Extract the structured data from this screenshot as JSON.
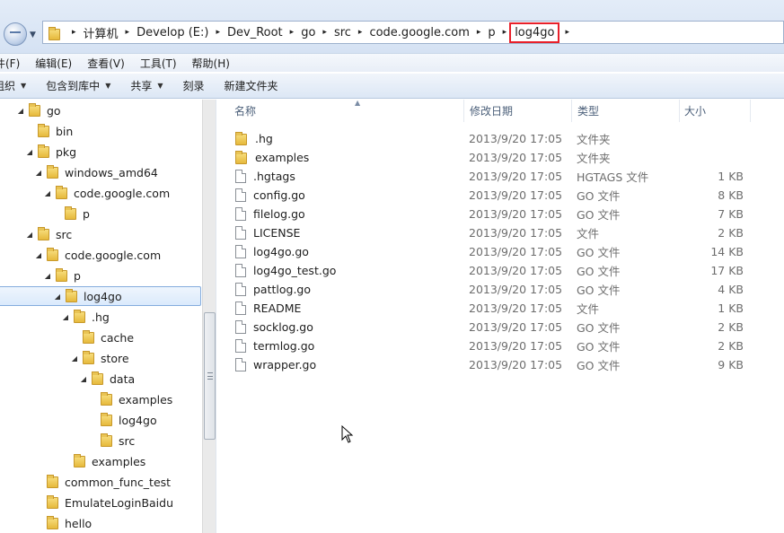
{
  "address": {
    "crumbs": [
      "计算机",
      "Develop (E:)",
      "Dev_Root",
      "go",
      "src",
      "code.google.com",
      "p"
    ],
    "current": "log4go"
  },
  "menu": [
    "件(F)",
    "编辑(E)",
    "查看(V)",
    "工具(T)",
    "帮助(H)"
  ],
  "commands": {
    "organize": "组织",
    "include_library": "包含到库中",
    "share": "共享",
    "burn": "刻录",
    "new_folder": "新建文件夹"
  },
  "tree": [
    {
      "label": "go",
      "expanded": true
    },
    {
      "label": "bin"
    },
    {
      "label": "pkg",
      "expanded": true
    },
    {
      "label": "windows_amd64",
      "expanded": true
    },
    {
      "label": "code.google.com",
      "expanded": true
    },
    {
      "label": "p"
    },
    {
      "label": "src",
      "expanded": true
    },
    {
      "label": "code.google.com",
      "expanded": true
    },
    {
      "label": "p",
      "expanded": true
    },
    {
      "label": "log4go",
      "expanded": true,
      "selected": true
    },
    {
      "label": ".hg",
      "expanded": true
    },
    {
      "label": "cache"
    },
    {
      "label": "store",
      "expanded": true
    },
    {
      "label": "data",
      "expanded": true
    },
    {
      "label": "examples"
    },
    {
      "label": "log4go"
    },
    {
      "label": "src"
    },
    {
      "label": "examples"
    },
    {
      "label": "common_func_test"
    },
    {
      "label": "EmulateLoginBaidu"
    },
    {
      "label": "hello"
    }
  ],
  "columns": {
    "name": "名称",
    "date": "修改日期",
    "type": "类型",
    "size": "大小"
  },
  "files": [
    {
      "name": ".hg",
      "date": "2013/9/20 17:05",
      "type": "文件夹",
      "size": "",
      "kind": "folder-icon"
    },
    {
      "name": "examples",
      "date": "2013/9/20 17:05",
      "type": "文件夹",
      "size": "",
      "kind": "folder-icon"
    },
    {
      "name": ".hgtags",
      "date": "2013/9/20 17:05",
      "type": "HGTAGS 文件",
      "size": "1 KB",
      "kind": "file-icon"
    },
    {
      "name": "config.go",
      "date": "2013/9/20 17:05",
      "type": "GO 文件",
      "size": "8 KB",
      "kind": "file-icon"
    },
    {
      "name": "filelog.go",
      "date": "2013/9/20 17:05",
      "type": "GO 文件",
      "size": "7 KB",
      "kind": "file-icon"
    },
    {
      "name": "LICENSE",
      "date": "2013/9/20 17:05",
      "type": "文件",
      "size": "2 KB",
      "kind": "file-icon"
    },
    {
      "name": "log4go.go",
      "date": "2013/9/20 17:05",
      "type": "GO 文件",
      "size": "14 KB",
      "kind": "file-icon"
    },
    {
      "name": "log4go_test.go",
      "date": "2013/9/20 17:05",
      "type": "GO 文件",
      "size": "17 KB",
      "kind": "file-icon"
    },
    {
      "name": "pattlog.go",
      "date": "2013/9/20 17:05",
      "type": "GO 文件",
      "size": "4 KB",
      "kind": "file-icon"
    },
    {
      "name": "README",
      "date": "2013/9/20 17:05",
      "type": "文件",
      "size": "1 KB",
      "kind": "file-icon"
    },
    {
      "name": "socklog.go",
      "date": "2013/9/20 17:05",
      "type": "GO 文件",
      "size": "2 KB",
      "kind": "file-icon"
    },
    {
      "name": "termlog.go",
      "date": "2013/9/20 17:05",
      "type": "GO 文件",
      "size": "2 KB",
      "kind": "file-icon"
    },
    {
      "name": "wrapper.go",
      "date": "2013/9/20 17:05",
      "type": "GO 文件",
      "size": "9 KB",
      "kind": "file-icon"
    }
  ],
  "colors": {
    "highlight_box": "#e8202a",
    "selection": "#dbeafc"
  }
}
